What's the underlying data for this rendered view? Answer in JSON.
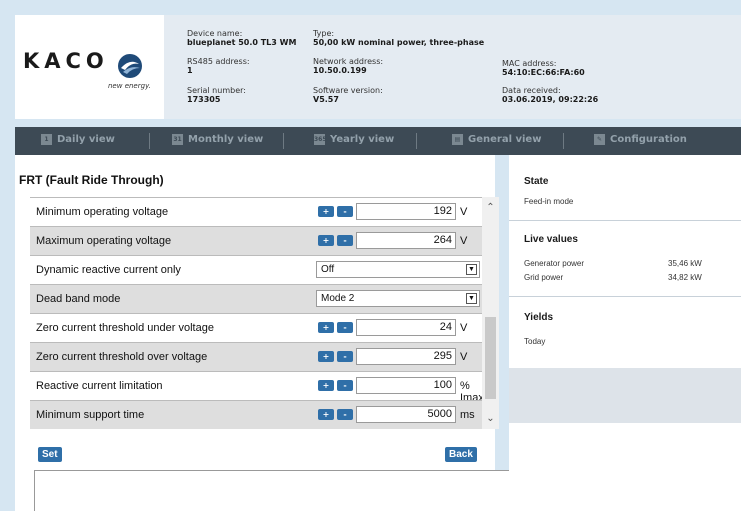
{
  "brand": {
    "logo": "KACO",
    "tagline": "new energy."
  },
  "device": {
    "name_label": "Device name:",
    "name_value": "blueplanet 50.0 TL3 WM",
    "type_label": "Type:",
    "type_value": "50,00 kW nominal power, three-phase",
    "rs485_label": "RS485 address:",
    "rs485_value": "1",
    "network_label": "Network address:",
    "network_value": "10.50.0.199",
    "mac_label": "MAC address:",
    "mac_value": "54:10:EC:66:FA:60",
    "serial_label": "Serial number:",
    "serial_value": "173305",
    "software_label": "Software version:",
    "software_value": "V5.57",
    "data_label": "Data received:",
    "data_value": "03.06.2019, 09:22:26"
  },
  "nav": {
    "daily": "Daily view",
    "monthly": "Monthly view",
    "yearly": "Yearly view",
    "general": "General view",
    "config": "Configuration",
    "daily_icon": "1",
    "monthly_icon": "31",
    "yearly_icon": "365"
  },
  "frt": {
    "title": "FRT (Fault Ride Through)",
    "rows": [
      {
        "label": "Minimum operating voltage",
        "value": "192",
        "unit": "V"
      },
      {
        "label": "Maximum operating voltage",
        "value": "264",
        "unit": "V"
      },
      {
        "label": "Dynamic reactive current only",
        "value": "Off"
      },
      {
        "label": "Dead band mode",
        "value": "Mode 2"
      },
      {
        "label": "Zero current threshold under voltage",
        "value": "24",
        "unit": "V"
      },
      {
        "label": "Zero current threshold over voltage",
        "value": "295",
        "unit": "V"
      },
      {
        "label": "Reactive current limitation",
        "value": "100",
        "unit": "% Imax"
      },
      {
        "label": "Minimum support time",
        "value": "5000",
        "unit": "ms"
      }
    ],
    "plus": "+",
    "minus": "-",
    "set_label": "Set",
    "back_label": "Back"
  },
  "panel": {
    "state_title": "State",
    "state_value": "Feed-in mode",
    "live_title": "Live values",
    "gen_label": "Generator power",
    "gen_value": "35,46 kW",
    "grid_label": "Grid power",
    "grid_value": "34,82 kW",
    "yields_title": "Yields",
    "today_label": "Today"
  },
  "colors": {
    "nav_bg": "#3d4a55",
    "accent": "#2f6fa8",
    "page_bg": "#d6e6f2"
  }
}
